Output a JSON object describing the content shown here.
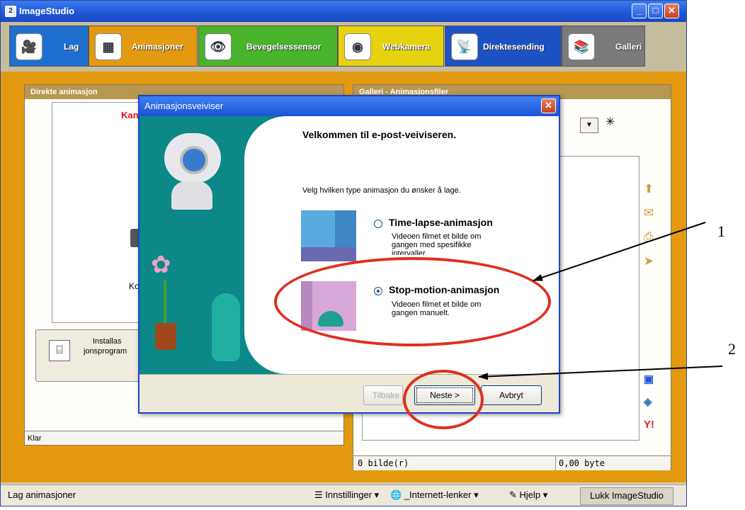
{
  "app": {
    "title": "ImageStudio"
  },
  "tabs": [
    {
      "label": "Lag",
      "color": "#1e6fd0"
    },
    {
      "label": "Animasjoner",
      "color": "#e39a10"
    },
    {
      "label": "Bevegelsessensor",
      "color": "#49b32c"
    },
    {
      "label": "Webkamera",
      "color": "#e6d20f"
    },
    {
      "label": "Direktesending",
      "color": "#1d52c4"
    },
    {
      "label": "Galleri",
      "color": "#7a7a7a"
    }
  ],
  "left_panel": {
    "header": "Direkte animasjon",
    "red_text": "Kan",
    "mid_text": "Kop",
    "install": {
      "line1": "Installas",
      "line2": "jonsprogram"
    },
    "status": "Klar"
  },
  "right_panel": {
    "header": "Galleri - Animasjonsfiler",
    "count": "0 bilde(r)",
    "size": "0,00 byte"
  },
  "statusbar": {
    "text": "Lag animasjoner",
    "settings": "Innstillinger",
    "links": "_Internett-lenker",
    "help": "Hjelp",
    "close": "Lukk ImageStudio"
  },
  "dialog": {
    "title": "Animasjonsveiviser",
    "heading": "Velkommen til e-post-veiviseren.",
    "prompt": "Velg hvilken type animasjon du ønsker å lage.",
    "option1": {
      "title": "Time-lapse-animasjon",
      "desc1": "Videoen filmet et bilde om",
      "desc2": "gangen med spesifikke",
      "desc3": "intervaller.",
      "selected": false
    },
    "option2": {
      "title": "Stop-motion-animasjon",
      "desc1": "Videoen filmet et bilde om",
      "desc2": "gangen manuelt.",
      "selected": true
    },
    "back": "Tilbake",
    "next": "Neste >",
    "cancel": "Avbryt"
  },
  "annotations": {
    "label1": "1",
    "label2": "2"
  },
  "colors": {
    "annotation": "#e0301e",
    "dialog_side": "#0c8888",
    "frame": "#e39a10"
  }
}
